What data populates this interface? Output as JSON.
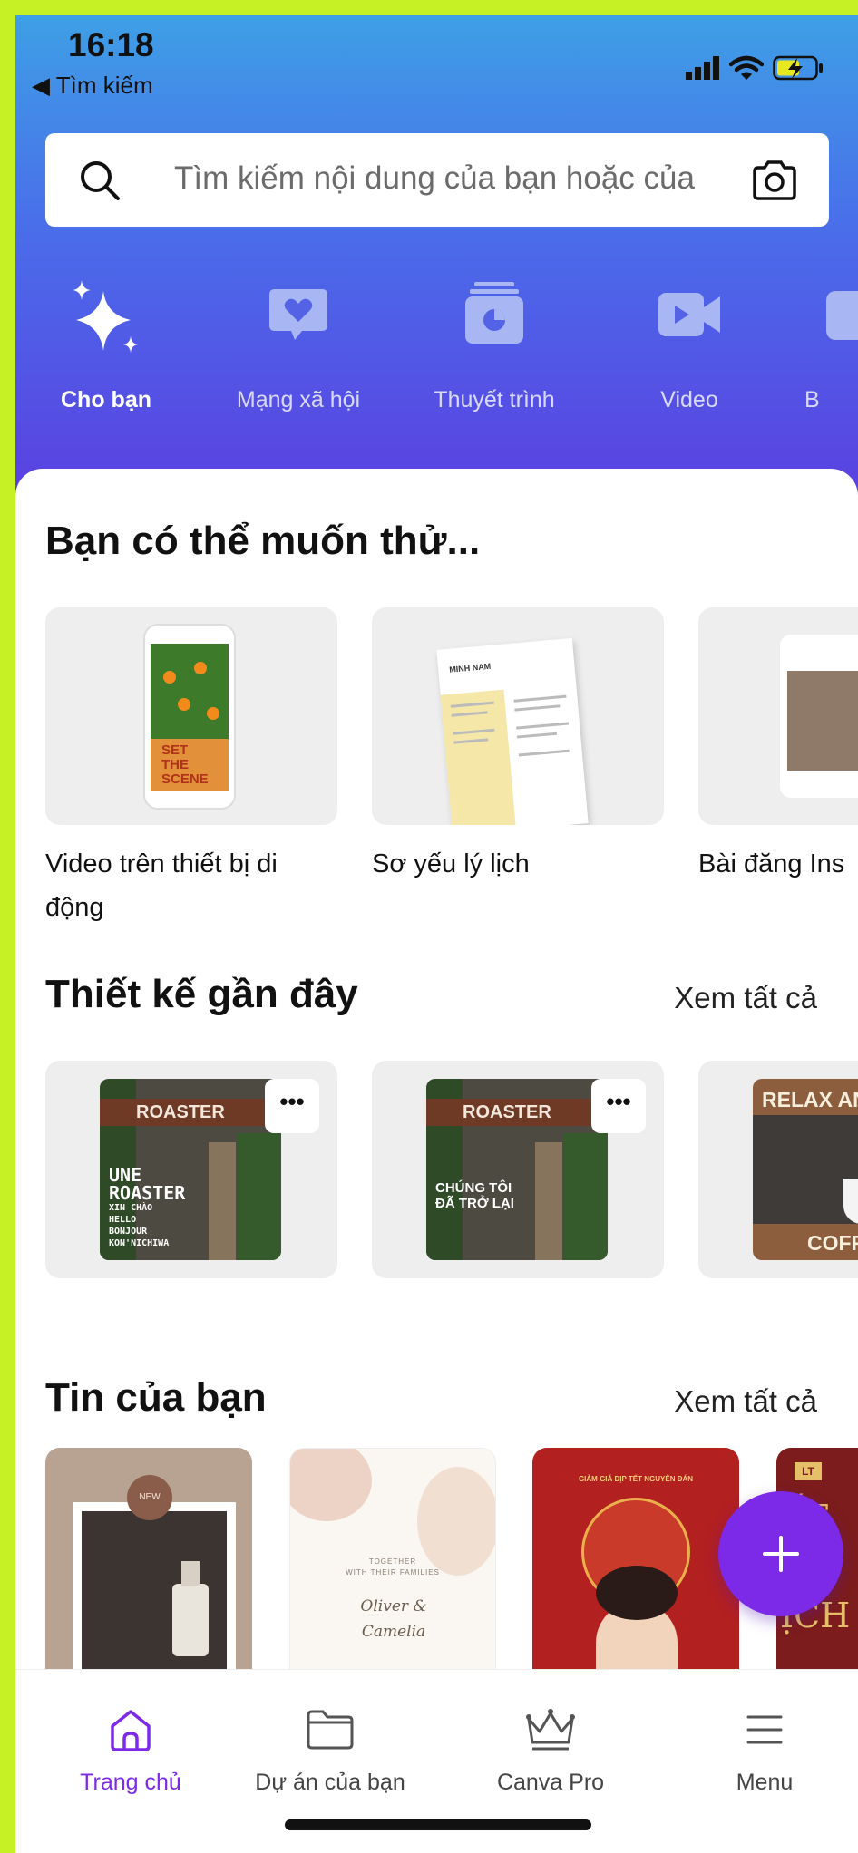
{
  "status": {
    "time": "16:18",
    "back_label": "◀ Tìm kiếm"
  },
  "search": {
    "placeholder": "Tìm kiếm nội dung của bạn hoặc của"
  },
  "categories": [
    {
      "label": "Cho bạn",
      "icon": "sparkle-icon"
    },
    {
      "label": "Mạng xã hội",
      "icon": "heart-chat-icon"
    },
    {
      "label": "Thuyết trình",
      "icon": "presentation-icon"
    },
    {
      "label": "Video",
      "icon": "video-camera-icon"
    },
    {
      "label": "B",
      "icon": "category-icon"
    }
  ],
  "try_section": {
    "title": "Bạn có thể muốn thử...",
    "items": [
      {
        "label": "Video trên thiết bị di động",
        "thumb_text": "SET THE SCENE"
      },
      {
        "label": "Sơ yếu lý lịch",
        "thumb_text": "MINH NAM"
      },
      {
        "label": "Bài đăng Ins"
      }
    ]
  },
  "recent": {
    "title": "Thiết kế gần đây",
    "see_all": "Xem tất cả",
    "items": [
      {
        "sign": "ROASTER",
        "lines": [
          "UNE",
          "ROASTER",
          "XIN CHÀO",
          "HELLO",
          "BONJOUR",
          "KON'NICHIWA"
        ],
        "more": "•••"
      },
      {
        "sign": "ROASTER",
        "lines": [
          "CHÚNG TÔI",
          "ĐÃ TRỞ LẠI"
        ],
        "more": "•••"
      },
      {
        "top": "RELAX AND",
        "bottom": "COFFEE"
      }
    ]
  },
  "stories": {
    "title": "Tin của bạn",
    "see_all": "Xem tất cả",
    "items": [
      {
        "badge": "NEW"
      },
      {
        "line1": "TOGETHER",
        "line2": "WITH THEIR FAMILIES",
        "names": "Oliver & Camelia"
      },
      {
        "caption": "GIẢM GIÁ DỊP TẾT NGUYÊN ĐÁN"
      },
      {
        "text": "ẾT M ỊCH",
        "logo": "LT"
      }
    ]
  },
  "fab": {
    "icon": "plus-icon"
  },
  "tabbar": {
    "items": [
      {
        "label": "Trang chủ",
        "icon": "home-icon",
        "active": true
      },
      {
        "label": "Dự án của bạn",
        "icon": "folder-icon"
      },
      {
        "label": "Canva Pro",
        "icon": "crown-icon"
      },
      {
        "label": "Menu",
        "icon": "menu-icon"
      }
    ]
  },
  "colors": {
    "accent": "#7d2ae8",
    "header_top": "#3e9fe6",
    "header_bottom": "#5b3fe0"
  }
}
